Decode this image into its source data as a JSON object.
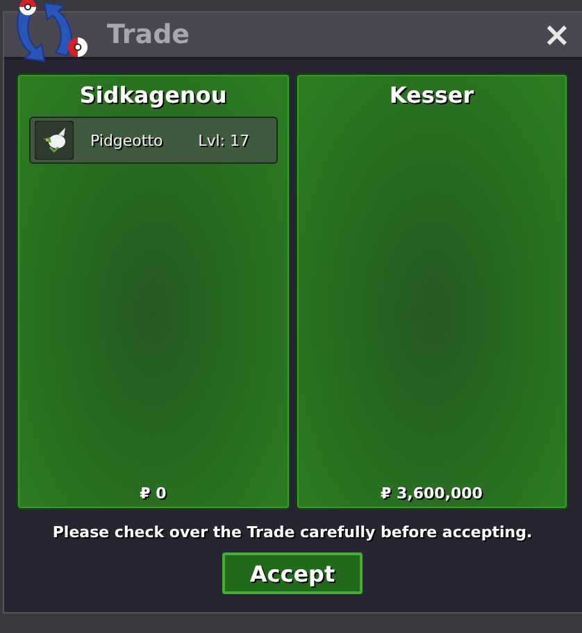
{
  "window": {
    "title": "Trade",
    "close": "×"
  },
  "panels": [
    {
      "name": "Sidkagenou",
      "items": [
        {
          "kind": "pokemon",
          "name": "Pidgeotto",
          "level": "Lvl: 17"
        }
      ],
      "money": "₽ 0"
    },
    {
      "name": "Kesser",
      "money": "₽ 3,600,000"
    }
  ],
  "notice": "Please check over the Trade carefully before accepting.",
  "buttons": [
    "Accept"
  ]
}
